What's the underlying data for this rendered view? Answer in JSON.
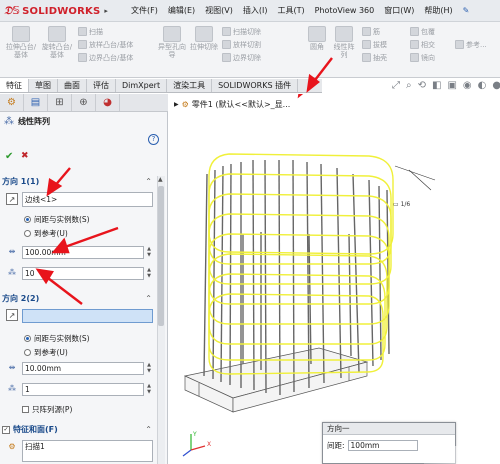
{
  "app": {
    "brand": "SOLIDWORKS",
    "menu": [
      "文件(F)",
      "编辑(E)",
      "视图(V)",
      "插入(I)",
      "工具(T)",
      "PhotoView 360",
      "窗口(W)",
      "帮助(H)"
    ]
  },
  "ribbon": {
    "big": [
      "拉伸凸台/基体",
      "旋转凸台/基体",
      "拉伸切除",
      "异型孔向导",
      "旋转切除",
      "圆角",
      "线性阵列"
    ],
    "small": [
      "扫描",
      "放样凸台/基体",
      "边界凸台/基体",
      "扫描切除",
      "放样切割",
      "边界切除",
      "筋",
      "拔模",
      "抽壳",
      "包覆",
      "相交",
      "镜向",
      "参考..."
    ]
  },
  "tabs": [
    "特征",
    "草图",
    "曲面",
    "评估",
    "DimXpert",
    "渲染工具",
    "SOLIDWORKS 插件"
  ],
  "tree": {
    "label": "零件1 (默认<<默认>_显..."
  },
  "panel": {
    "title": "线性阵列",
    "help": "?",
    "ok": "✔",
    "cancel": "✖",
    "dir1": {
      "header": "方向 1(1)",
      "edge": "边线<1>",
      "opt1": "间距与实例数(S)",
      "opt2": "到参考(U)",
      "spacing": "100.00mm",
      "count": "10"
    },
    "dir2": {
      "header": "方向 2(2)",
      "edge": "",
      "opt1": "间距与实例数(S)",
      "opt2": "到参考(U)",
      "spacing": "10.00mm",
      "count": "1",
      "seed_only": "只阵列源(P)"
    },
    "features": {
      "header": "特征和面(F)",
      "item": "扫描1"
    }
  },
  "popup": {
    "title": "方向一",
    "label": "间距:",
    "value": "100mm"
  },
  "colors": {
    "accent": "#d0202a",
    "arrow": "#e8141c",
    "wire": "#f0f03a",
    "selected": "#cfe2f7"
  }
}
